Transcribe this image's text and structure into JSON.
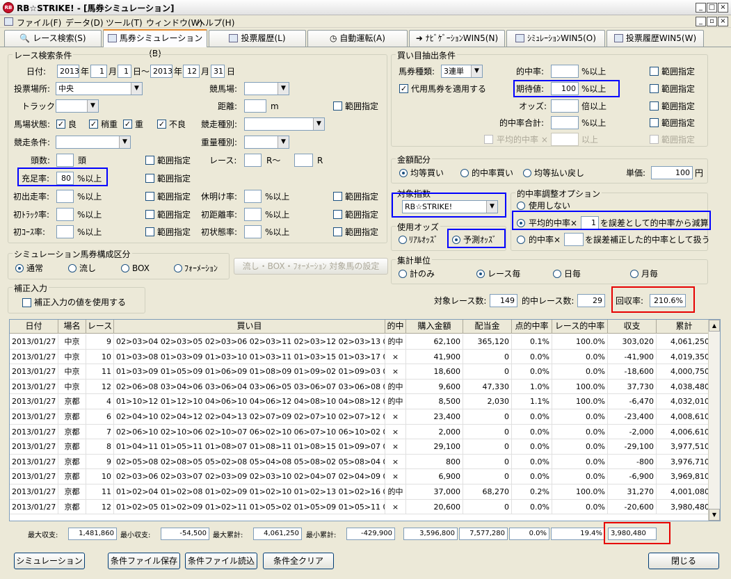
{
  "window": {
    "title": "RB☆STRIKE! - [馬券シミュレーション]",
    "logo_text": "RB"
  },
  "menu": [
    "ファイル(F)",
    "データ(D)",
    "ツール(T)",
    "ウィンドウ(W)",
    "ヘルプ(H)"
  ],
  "tabs": [
    "レース検索(S)",
    "馬券シミュレーション(B)",
    "投票履歴(L)",
    "自動運転(A)",
    "ﾅﾋﾞｹﾞｰｼｮﾝWIN5(N)",
    "ｼﾐｭﾚｰｼｮﾝWIN5(O)",
    "投票履歴WIN5(W)"
  ],
  "race": {
    "title": "レース検索条件",
    "date_label": "日付:",
    "from_year": "2013",
    "year": "年",
    "from_month": "1",
    "month": "月",
    "from_day": "1",
    "day_sep": "日～",
    "to_year": "2013",
    "to_month": "12",
    "to_day": "31",
    "day": "日",
    "venue_label": "投票場所:",
    "venue": "中央",
    "course_label": "競馬場:",
    "track_label": "トラック:",
    "distance_label": "距離:",
    "distance_unit": "m",
    "range": "範囲指定",
    "condition_label": "馬場状態:",
    "cond_good": "良",
    "cond_slightly": "稍重",
    "cond_heavy": "重",
    "cond_bad": "不良",
    "race_type_label": "競走種別:",
    "race_cond_label": "競走条件:",
    "weight_label": "重量種別:",
    "heads_label": "頭数:",
    "heads_unit": "頭",
    "race_label": "レース:",
    "race_from": "R～",
    "race_to": "R",
    "fill_label": "充足率:",
    "fill_value": "80",
    "pct_over": "%以上",
    "first_run_label": "初出走率:",
    "rest_label": "休明け率:",
    "first_track_label": "初ﾄﾗｯｸ率:",
    "first_dist_label": "初距離率:",
    "first_course_label": "初ｺｰｽ率:",
    "first_state_label": "初状態率:"
  },
  "sim": {
    "title": "シミュレーション馬券構成区分",
    "opts": [
      "通常",
      "流し",
      "BOX",
      "ﾌｫｰﾒｰｼｮﾝ"
    ],
    "btn": "流し・BOX・ﾌｫｰﾒｰｼｮﾝ 対象馬の設定"
  },
  "corr": {
    "title": "補正入力",
    "check": "補正入力の値を使用する"
  },
  "buy": {
    "title": "買い目抽出条件",
    "type_label": "馬券種類:",
    "type": "3連単",
    "hit_label": "的中率:",
    "pct_over": "%以上",
    "range": "範囲指定",
    "sub_label": "代用馬券を適用する",
    "expect_label": "期待値:",
    "expect_value": "100",
    "odds_label": "オッズ:",
    "odds_unit": "倍以上",
    "hit_total_label": "的中率合計:",
    "avg_hit_label": "平均的中率 ×",
    "over": "以上"
  },
  "money": {
    "title": "金額配分",
    "opts": [
      "均等買い",
      "的中率買い",
      "均等払い戻し"
    ],
    "unit_label": "単価:",
    "unit_value": "100",
    "yen": "円"
  },
  "index": {
    "title": "対象指数",
    "value": "RB☆STRIKE!"
  },
  "odds": {
    "title": "使用オッズ",
    "opts": [
      "ﾘｱﾙｵｯｽﾞ",
      "予測ｵｯｽﾞ"
    ]
  },
  "adjust": {
    "title": "的中率調整オプション",
    "none": "使用しない",
    "avg_pre": "平均的中率×",
    "avg_value": "1",
    "avg_post": "を誤差として的中率から減算",
    "hit_pre": "的中率×",
    "hit_post": "を誤差補正した的中率として扱う"
  },
  "agg": {
    "title": "集計単位",
    "opts": [
      "計のみ",
      "レース毎",
      "日毎",
      "月毎"
    ]
  },
  "stats": {
    "target_label": "対象レース数:",
    "target_value": "149",
    "hit_label": "的中レース数:",
    "hit_value": "29",
    "recovery_label": "回収率:",
    "recovery_value": "210.6%"
  },
  "grid": {
    "headers": [
      "日付",
      "場名",
      "レース",
      "買い目",
      "的中",
      "購入金額",
      "配当金",
      "点的中率",
      "レース的中率",
      "収支",
      "累計"
    ],
    "rows": [
      [
        "2013/01/27",
        "中京",
        "9",
        "02>03>04 02>03>05 02>03>06 02>03>11 02>03>12 02>03>13 02>03>14 02>",
        "的中",
        "62,100",
        "365,120",
        "0.1%",
        "100.0%",
        "303,020",
        "4,061,250"
      ],
      [
        "2013/01/27",
        "中京",
        "10",
        "01>03>08 01>03>09 01>03>10 01>03>11 01>03>15 01>03>17 01>05>08 01>",
        "×",
        "41,900",
        "0",
        "0.0%",
        "0.0%",
        "-41,900",
        "4,019,350"
      ],
      [
        "2013/01/27",
        "中京",
        "11",
        "01>03>09 01>05>09 01>06>09 01>08>09 01>09>02 01>09>03 01>09>05 01>",
        "×",
        "18,600",
        "0",
        "0.0%",
        "0.0%",
        "-18,600",
        "4,000,750"
      ],
      [
        "2013/01/27",
        "中京",
        "12",
        "02>06>08 03>04>06 03>06>04 03>06>05 03>06>07 03>06>08 03>07>06 03>",
        "的中",
        "9,600",
        "47,330",
        "1.0%",
        "100.0%",
        "37,730",
        "4,038,480"
      ],
      [
        "2013/01/27",
        "京都",
        "4",
        "01>10>12 01>12>10 04>06>10 04>06>12 04>08>10 04>08>12 04>09>10 04>",
        "的中",
        "8,500",
        "2,030",
        "1.1%",
        "100.0%",
        "-6,470",
        "4,032,010"
      ],
      [
        "2013/01/27",
        "京都",
        "6",
        "02>04>10 02>04>12 02>04>13 02>07>09 02>07>10 02>07>12 02>07>13 02>",
        "×",
        "23,400",
        "0",
        "0.0%",
        "0.0%",
        "-23,400",
        "4,008,610"
      ],
      [
        "2013/01/27",
        "京都",
        "7",
        "02>06>10 02>10>06 02>10>07 06>02>10 06>07>10 06>10>02 06>10>07 06>",
        "×",
        "2,000",
        "0",
        "0.0%",
        "0.0%",
        "-2,000",
        "4,006,610"
      ],
      [
        "2013/01/27",
        "京都",
        "8",
        "01>04>11 01>05>11 01>08>07 01>08>11 01>08>15 01>09>07 01>09>11 01>",
        "×",
        "29,100",
        "0",
        "0.0%",
        "0.0%",
        "-29,100",
        "3,977,510"
      ],
      [
        "2013/01/27",
        "京都",
        "9",
        "02>05>08 02>08>05 05>02>08 05>04>08 05>08>02 05>08>04 05>08>06 08>",
        "×",
        "800",
        "0",
        "0.0%",
        "0.0%",
        "-800",
        "3,976,710"
      ],
      [
        "2013/01/27",
        "京都",
        "10",
        "02>03>06 02>03>07 02>03>09 02>03>10 02>04>07 02>04>09 02>05>06 02>",
        "×",
        "6,900",
        "0",
        "0.0%",
        "0.0%",
        "-6,900",
        "3,969,810"
      ],
      [
        "2013/01/27",
        "京都",
        "11",
        "01>02>04 01>02>08 01>02>09 01>02>10 01>02>13 01>02>16 01>03>09 01>",
        "的中",
        "37,000",
        "68,270",
        "0.2%",
        "100.0%",
        "31,270",
        "4,001,080"
      ],
      [
        "2013/01/27",
        "京都",
        "12",
        "01>02>05 01>02>09 01>02>11 01>05>02 01>05>09 01>05>11 01>09>02 01>",
        "×",
        "20,600",
        "0",
        "0.0%",
        "0.0%",
        "-20,600",
        "3,980,480"
      ]
    ]
  },
  "summary": {
    "max_profit_label": "最大収支:",
    "max_profit": "1,481,860",
    "min_profit_label": "最小収支:",
    "min_profit": "-54,500",
    "max_cum_label": "最大累計:",
    "max_cum": "4,061,250",
    "min_cum_label": "最小累計:",
    "min_cum": "-429,900",
    "total_buy": "3,596,800",
    "total_pay": "7,577,280",
    "point_hit": "0.0%",
    "race_hit": "19.4%",
    "final_cum": "3,980,480"
  },
  "buttons": {
    "simulate": "シミュレーション",
    "save": "条件ファイル保存",
    "load": "条件ファイル読込",
    "clear": "条件全クリア",
    "close": "閉じる"
  }
}
